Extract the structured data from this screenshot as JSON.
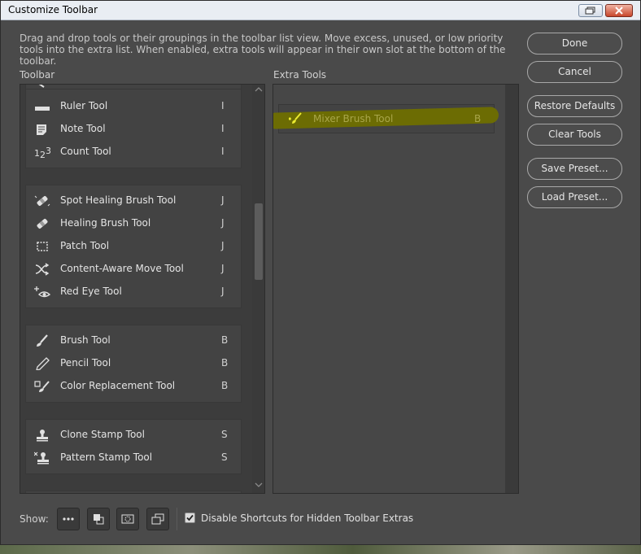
{
  "window": {
    "title": "Customize Toolbar",
    "description": "Drag and drop tools or their groupings in the toolbar list view. Move excess, unused, or low priority tools into the extra list. When enabled, extra tools will appear in their own slot at the bottom of the toolbar."
  },
  "toolbar": {
    "label": "Toolbar",
    "groups": [
      {
        "tools": [
          {
            "label": "Ruler Tool",
            "key": "I",
            "icon": "ruler-icon"
          },
          {
            "label": "Note Tool",
            "key": "I",
            "icon": "note-icon"
          },
          {
            "label": "Count Tool",
            "key": "I",
            "icon": "count-icon"
          }
        ]
      },
      {
        "tools": [
          {
            "label": "Spot Healing Brush Tool",
            "key": "J",
            "icon": "spot-healing-icon"
          },
          {
            "label": "Healing Brush Tool",
            "key": "J",
            "icon": "healing-brush-icon"
          },
          {
            "label": "Patch Tool",
            "key": "J",
            "icon": "patch-icon"
          },
          {
            "label": "Content-Aware Move Tool",
            "key": "J",
            "icon": "content-aware-move-icon"
          },
          {
            "label": "Red Eye Tool",
            "key": "J",
            "icon": "red-eye-icon"
          }
        ]
      },
      {
        "tools": [
          {
            "label": "Brush Tool",
            "key": "B",
            "icon": "brush-icon"
          },
          {
            "label": "Pencil Tool",
            "key": "B",
            "icon": "pencil-icon"
          },
          {
            "label": "Color Replacement Tool",
            "key": "B",
            "icon": "color-replacement-icon"
          }
        ]
      },
      {
        "tools": [
          {
            "label": "Clone Stamp Tool",
            "key": "S",
            "icon": "clone-stamp-icon"
          },
          {
            "label": "Pattern Stamp Tool",
            "key": "S",
            "icon": "pattern-stamp-icon"
          }
        ]
      }
    ]
  },
  "extra_tools": {
    "label": "Extra Tools",
    "tools": [
      {
        "label": "Mixer Brush Tool",
        "key": "B",
        "icon": "mixer-brush-icon",
        "highlight_color": "#6f6f00"
      }
    ]
  },
  "buttons": {
    "done": "Done",
    "cancel": "Cancel",
    "restore_defaults": "Restore Defaults",
    "clear_tools": "Clear Tools",
    "save_preset": "Save Preset...",
    "load_preset": "Load Preset..."
  },
  "bottom": {
    "show_label": "Show:",
    "show_options": [
      "more-icon",
      "foreground-background-icon",
      "quick-mask-icon",
      "screen-mode-icon"
    ],
    "checkbox_label": "Disable Shortcuts for Hidden Toolbar Extras",
    "checkbox_checked": true
  },
  "colors": {
    "dialog_bg": "#4a4a4a",
    "panel_bg": "#3c3c3c",
    "highlight": "#6f6f00"
  }
}
